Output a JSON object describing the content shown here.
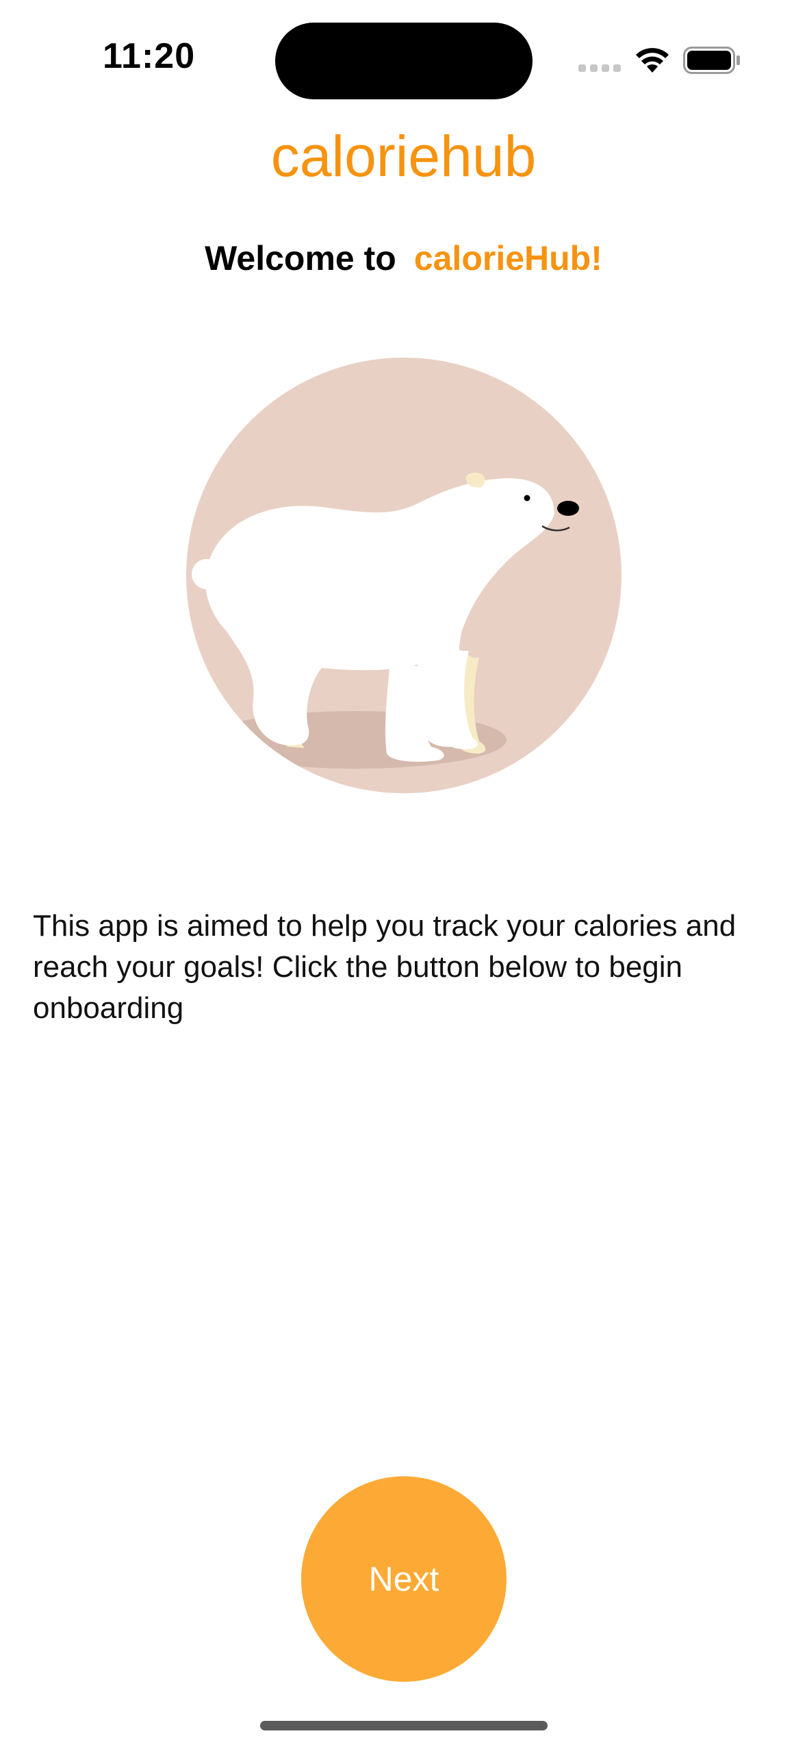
{
  "status_bar": {
    "time": "11:20"
  },
  "colors": {
    "brand_orange": "#f6930f",
    "button_orange": "#fcaa35",
    "illustration_bg": "#e8d0c4"
  },
  "header": {
    "app_title": "caloriehub",
    "welcome_prefix": "Welcome to",
    "welcome_brand": "calorieHub!"
  },
  "illustration": {
    "icon": "polar-bear-illustration"
  },
  "body": {
    "description": "This app is aimed to help you track your calories and reach your goals! Click the button below to begin onboarding"
  },
  "actions": {
    "next_label": "Next"
  }
}
